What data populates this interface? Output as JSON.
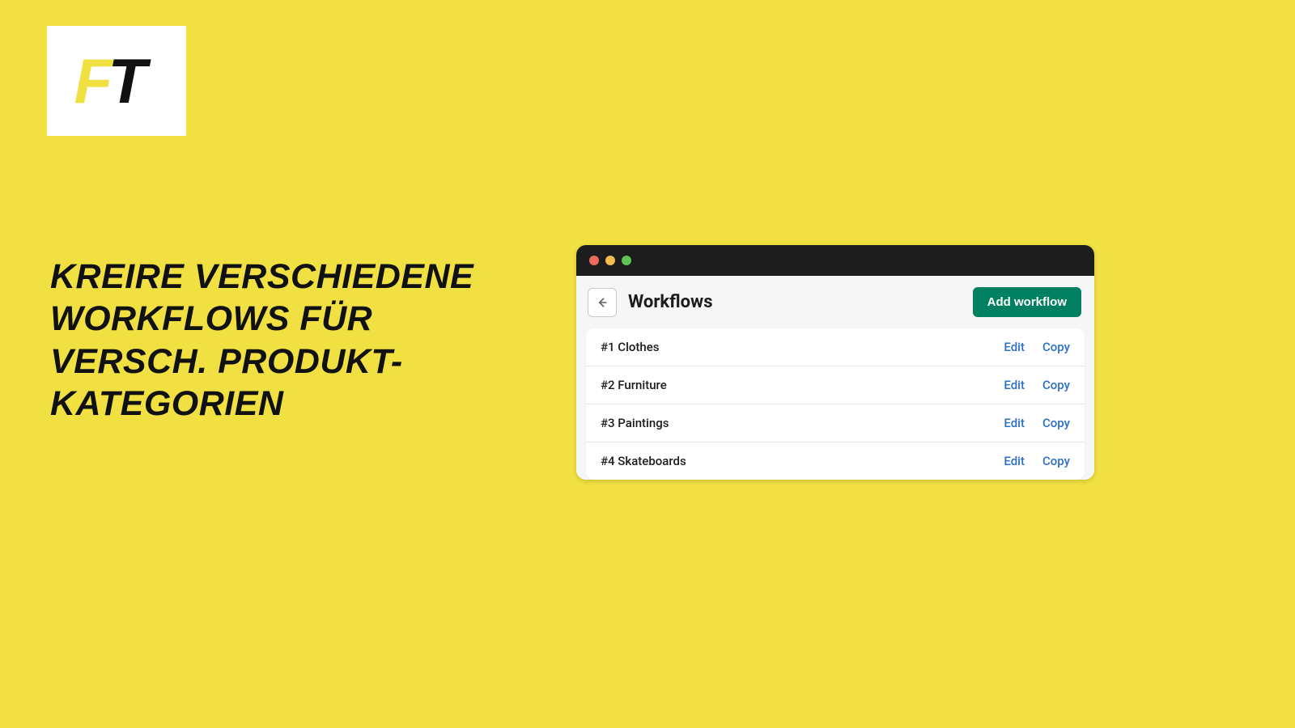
{
  "logo": {
    "letter1": "F",
    "letter2": "T"
  },
  "headline": "KREIRE VERSCHIEDENE WORKFLOWS FÜR VERSCH. PRODUKT-KATEGORIEN",
  "window": {
    "title": "Workflows",
    "add_button": "Add workflow",
    "actions": {
      "edit": "Edit",
      "copy": "Copy"
    },
    "rows": [
      {
        "name": "#1 Clothes"
      },
      {
        "name": "#2 Furniture"
      },
      {
        "name": "#3 Paintings"
      },
      {
        "name": "#4 Skateboards"
      }
    ]
  }
}
